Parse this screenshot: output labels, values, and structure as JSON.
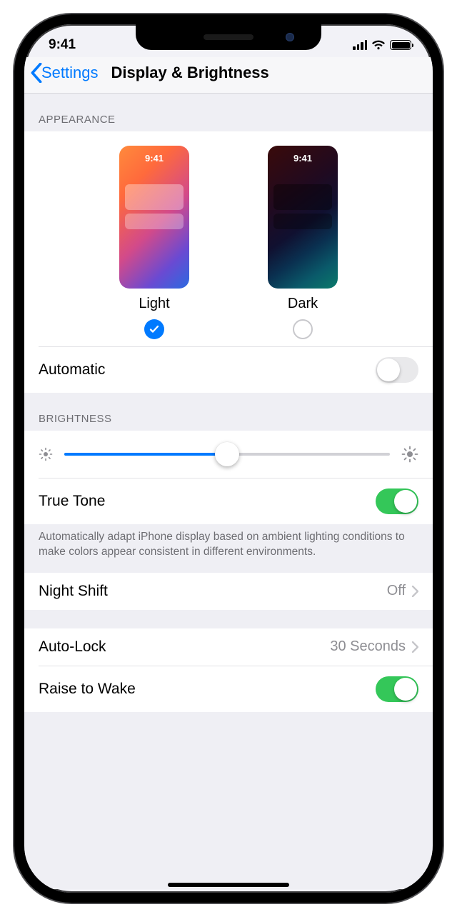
{
  "statusbar": {
    "time": "9:41"
  },
  "nav": {
    "back": "Settings",
    "title": "Display & Brightness"
  },
  "appearance": {
    "header": "APPEARANCE",
    "thumb_time": "9:41",
    "light_label": "Light",
    "dark_label": "Dark",
    "selected": "light",
    "automatic_label": "Automatic",
    "automatic_on": false
  },
  "brightness": {
    "header": "BRIGHTNESS",
    "value_percent": 50,
    "true_tone_label": "True Tone",
    "true_tone_on": true,
    "true_tone_note": "Automatically adapt iPhone display based on ambient lighting conditions to make colors appear consistent in different environments."
  },
  "night_shift": {
    "label": "Night Shift",
    "value": "Off"
  },
  "auto_lock": {
    "label": "Auto-Lock",
    "value": "30 Seconds"
  },
  "raise_to_wake": {
    "label": "Raise to Wake",
    "on": true
  }
}
